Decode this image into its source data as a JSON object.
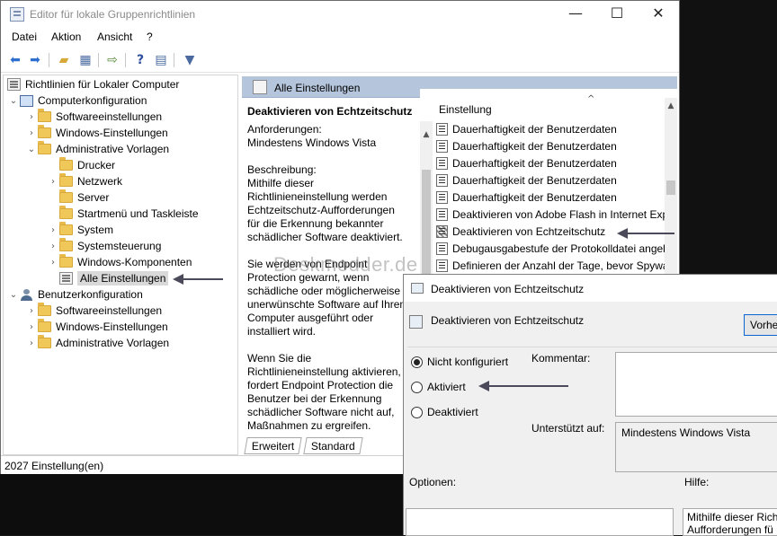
{
  "window": {
    "title": "Editor für lokale Gruppenrichtlinien",
    "minimize": "—",
    "maximize": "☐",
    "close": "✕"
  },
  "menu": [
    "Datei",
    "Aktion",
    "Ansicht",
    "?"
  ],
  "toolbar": {
    "icons": [
      "back-icon",
      "forward-icon",
      "up-folder-icon",
      "show-hide-tree-icon",
      "export-list-icon",
      "help-icon",
      "properties-icon",
      "filter-icon"
    ]
  },
  "tree": {
    "root": "Richtlinien für Lokaler Computer",
    "computer": "Computerkonfiguration",
    "computer_children": [
      "Softwareeinstellungen",
      "Windows-Einstellungen",
      "Administrative Vorlagen"
    ],
    "admin_children": [
      "Drucker",
      "Netzwerk",
      "Server",
      "Startmenü und Taskleiste",
      "System",
      "Systemsteuerung",
      "Windows-Komponenten",
      "Alle Einstellungen"
    ],
    "user": "Benutzerkonfiguration",
    "user_children": [
      "Softwareeinstellungen",
      "Windows-Einstellungen",
      "Administrative Vorlagen"
    ]
  },
  "right_pane": {
    "header": "Alle Einstellungen",
    "desc_title": "Deaktivieren von Echtzeitschutz",
    "desc_body": "Anforderungen:\nMindestens Windows Vista\n\nBeschreibung:\nMithilfe dieser\nRichtlinieneinstellung werden\nEchtzeitschutz-Aufforderungen\nfür die Erkennung bekannter\nschädlicher Software deaktiviert.\n\n    Sie werden von Endpoint\nProtection gewarnt, wenn\nschädliche oder möglicherweise\nunerwünschte Software auf Ihrem\nComputer ausgeführt oder\ninstalliert wird.\n\n    Wenn Sie die\nRichtlinieneinstellung aktivieren,\nfordert Endpoint Protection die\nBenutzer bei der Erkennung\nschädlicher Software nicht auf,\nMaßnahmen zu ergreifen.",
    "tabs": [
      "Erweitert",
      "Standard"
    ],
    "list_header": "Einstellung",
    "list_items": [
      "Dauerhaftigkeit der Benutzerdaten",
      "Dauerhaftigkeit der Benutzerdaten",
      "Dauerhaftigkeit der Benutzerdaten",
      "Dauerhaftigkeit der Benutzerdaten",
      "Dauerhaftigkeit der Benutzerdaten",
      "Deaktivieren von Adobe Flash in Internet Exp",
      "Deaktivieren von Echtzeitschutz",
      "Debugausgabestufe der Protokolldatei angel",
      "Definieren der Anzahl der Tage, bevor Spywa"
    ]
  },
  "status": "2027 Einstellung(en)",
  "watermark": "Deskmodder.de",
  "dialog": {
    "title": "Deaktivieren von Echtzeitschutz",
    "heading": "Deaktivieren von Echtzeitschutz",
    "button": "Vorhe",
    "radios": [
      "Nicht konfiguriert",
      "Aktiviert",
      "Deaktiviert"
    ],
    "comment_label": "Kommentar:",
    "supported_label": "Unterstützt auf:",
    "supported_value": "Mindestens Windows Vista",
    "options_label": "Optionen:",
    "help_label": "Hilfe:",
    "help_text": "Mithilfe dieser Richt\nAufforderungen fü"
  }
}
